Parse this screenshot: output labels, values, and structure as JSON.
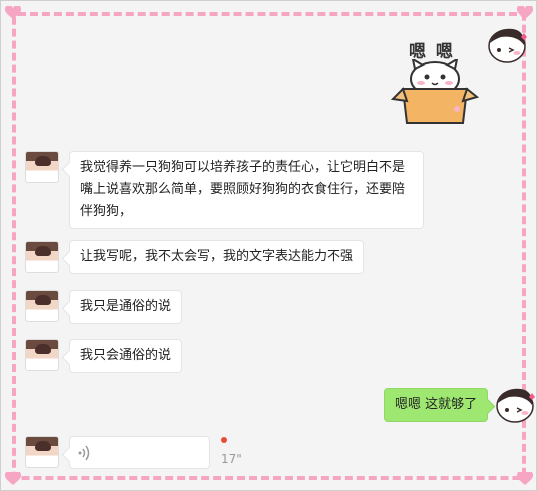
{
  "sticker_text": "嗯 嗯",
  "messages": [
    {
      "text": "我觉得养一只狗狗可以培养孩子的责任心，让它明白不是嘴上说喜欢那么简单，要照顾好狗狗的衣食住行，还要陪伴狗狗，"
    },
    {
      "text": "让我写呢，我不太会写，我的文字表达能力不强"
    },
    {
      "text": "我只是通俗的说"
    },
    {
      "text": "我只会通俗的说"
    }
  ],
  "my_reply": "嗯嗯 这就够了",
  "voice_message": {
    "duration": "17\""
  },
  "colors": {
    "dash_border": "#f6a5c2",
    "sent_bubble": "#9ee872",
    "unread_dot": "#e84a3b"
  }
}
